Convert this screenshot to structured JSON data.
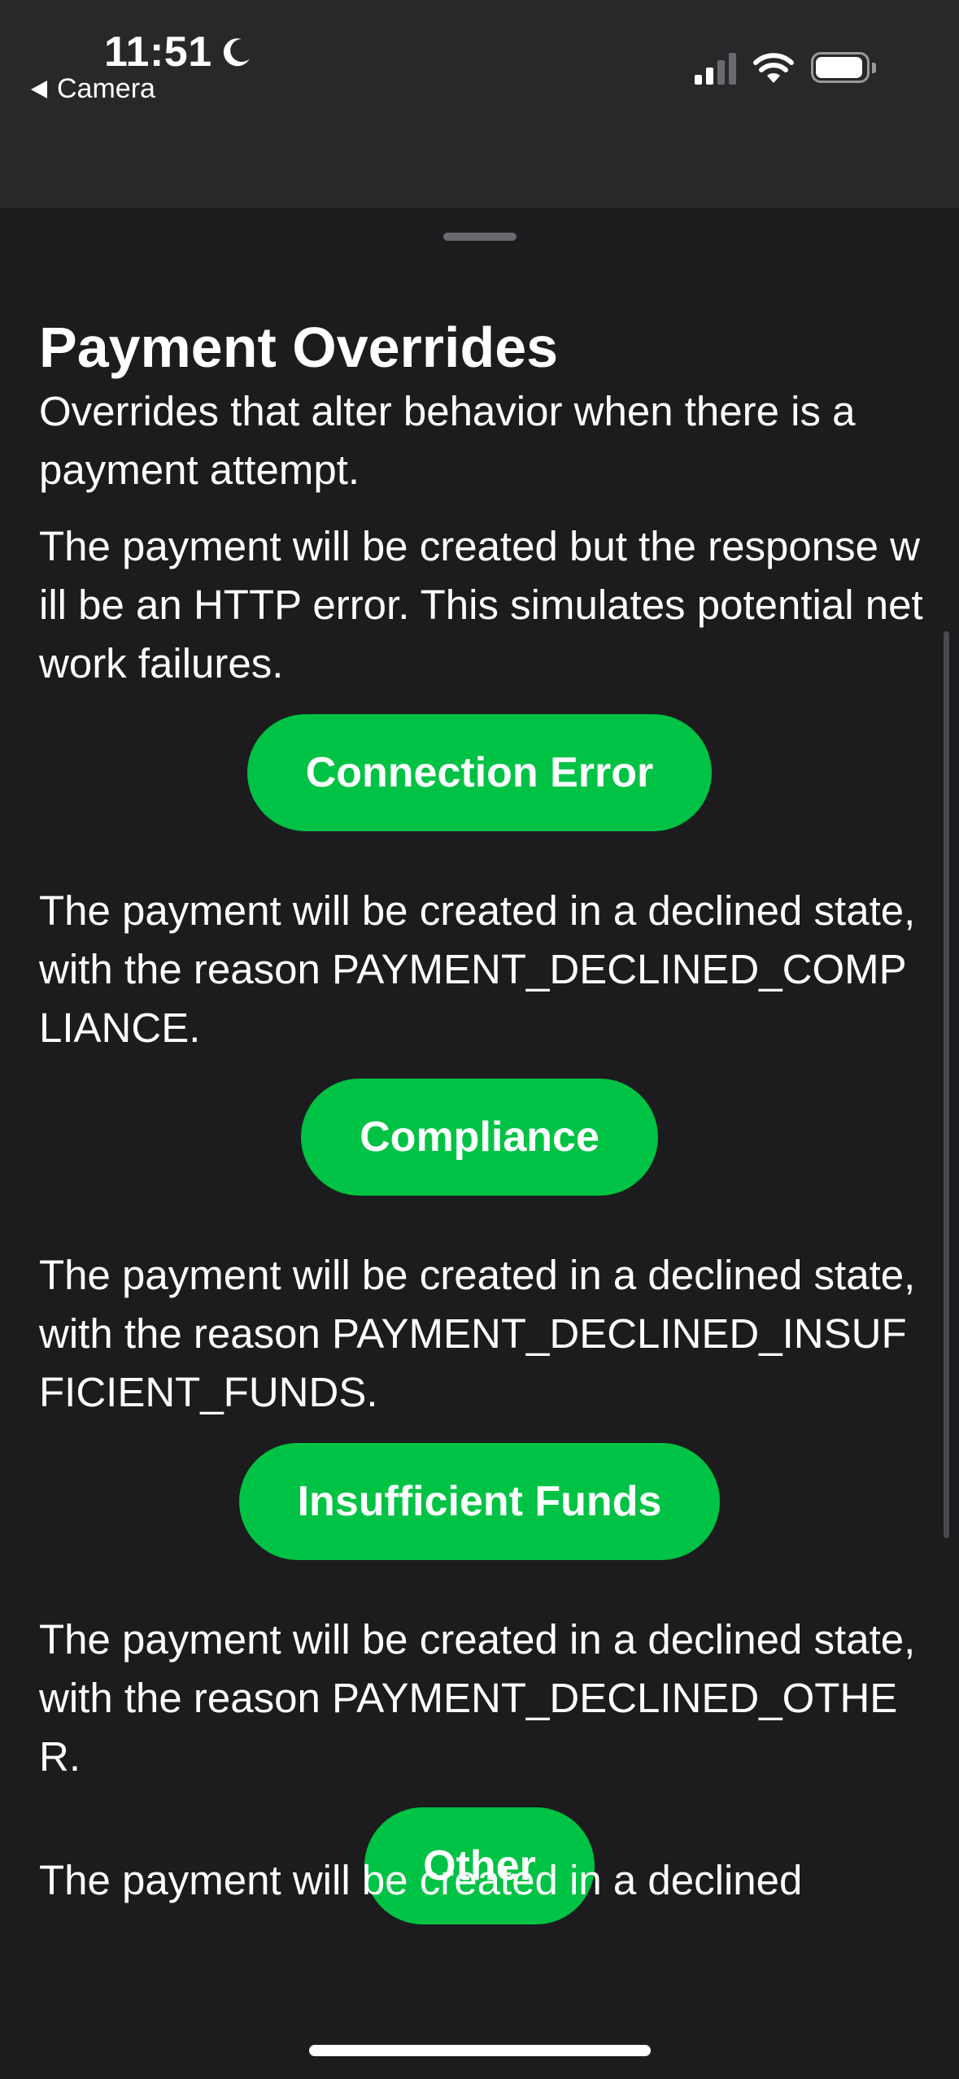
{
  "status_bar": {
    "time": "11:51",
    "back_app": "Camera",
    "signal_bars_active": 2,
    "signal_bars_total": 4,
    "battery_level": 0.95
  },
  "sheet": {
    "title": "Payment Overrides",
    "subtitle": "Overrides that alter behavior when there is a payment attempt.",
    "sections": [
      {
        "description": "The payment will be created but the response will be an HTTP error. This simulates potential network failures.",
        "button_label": "Connection Error"
      },
      {
        "description": "The payment will be created in a declined state, with the reason PAYMENT_DECLINED_COMPLIANCE.",
        "button_label": "Compliance"
      },
      {
        "description": "The payment will be created in a declined state, with the reason PAYMENT_DECLINED_INSUFFICIENT_FUNDS.",
        "button_label": "Insufficient Funds"
      },
      {
        "description": "The payment will be created in a declined state, with the reason PAYMENT_DECLINED_OTHER.",
        "button_label": "Other"
      }
    ],
    "partial_next_description": "The payment will be created in a declined"
  },
  "colors": {
    "accent_green": "#00c244",
    "background": "#1c1c1e",
    "status_bar_bg": "#28282a"
  },
  "icons": [
    "moon-icon",
    "back-arrow-icon",
    "cellular-signal-icon",
    "wifi-icon",
    "battery-icon"
  ]
}
